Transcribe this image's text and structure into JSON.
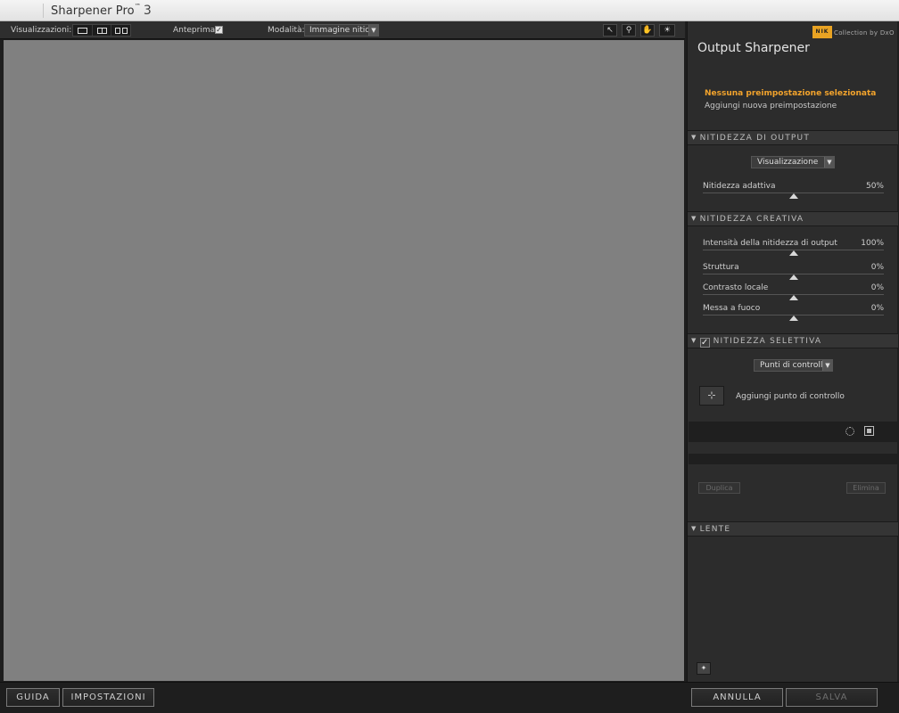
{
  "window": {
    "title": "Sharpener Pro",
    "title_tm": "™",
    "version": "3"
  },
  "toolbar": {
    "views_label": "Visualizzazioni:",
    "preview_label": "Anteprima:",
    "preview_checked": "✓",
    "mode_label": "Modalità:",
    "mode_value": "Immagine nitida"
  },
  "panel": {
    "brand_logo": "NIK",
    "brand_text": "Collection by DxO",
    "title": "Output Sharpener",
    "preset_name": "Nessuna preimpostazione selezionata",
    "preset_add": "Aggiungi nuova preimpostazione",
    "output_section": {
      "title": "NITIDEZZA DI OUTPUT",
      "dropdown": "Visualizzazione",
      "sliders": [
        {
          "name": "Nitidezza adattiva",
          "value": "50%",
          "level": 0.5
        }
      ]
    },
    "creative_section": {
      "title": "NITIDEZZA CREATIVA",
      "sliders": [
        {
          "name": "Intensità della nitidezza di output",
          "value": "100%",
          "level": 0.5
        },
        {
          "name": "Struttura",
          "value": "0%",
          "level": 0.5
        },
        {
          "name": "Contrasto locale",
          "value": "0%",
          "level": 0.5
        },
        {
          "name": "Messa a fuoco",
          "value": "0%",
          "level": 0.5
        }
      ]
    },
    "selective_section": {
      "title": "NITIDEZZA SELETTIVA",
      "checked": "✓",
      "dropdown": "Punti di controllo",
      "add_point_label": "Aggiungi punto di controllo",
      "duplicate_label": "Duplica",
      "delete_label": "Elimina"
    },
    "loupe_section": {
      "title": "LENTE"
    }
  },
  "bottom": {
    "help": "GUIDA",
    "settings": "IMPOSTAZIONI",
    "cancel": "ANNULLA",
    "save": "SALVA"
  }
}
